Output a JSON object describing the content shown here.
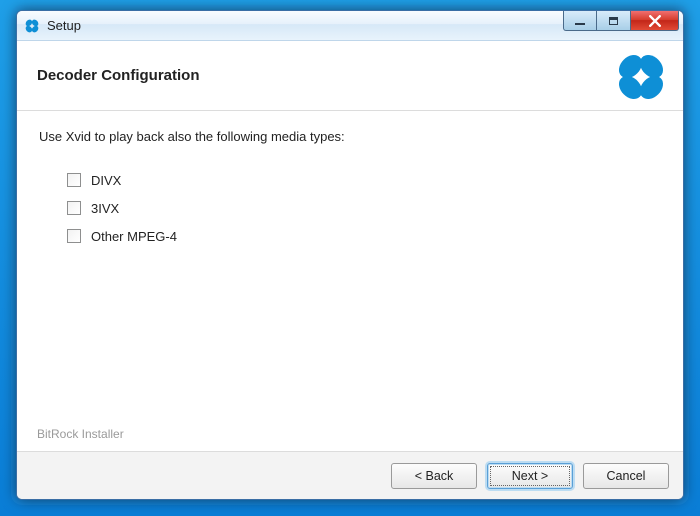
{
  "window": {
    "title": "Setup"
  },
  "header": {
    "page_title": "Decoder Configuration"
  },
  "content": {
    "instruction": "Use Xvid to play back also the following media types:",
    "options": [
      {
        "label": "DIVX",
        "checked": false
      },
      {
        "label": "3IVX",
        "checked": false
      },
      {
        "label": "Other MPEG-4",
        "checked": false
      }
    ]
  },
  "branding": "BitRock Installer",
  "footer": {
    "back_label": "< Back",
    "next_label": "Next >",
    "cancel_label": "Cancel"
  },
  "colors": {
    "accent": "#0e8fd6"
  }
}
